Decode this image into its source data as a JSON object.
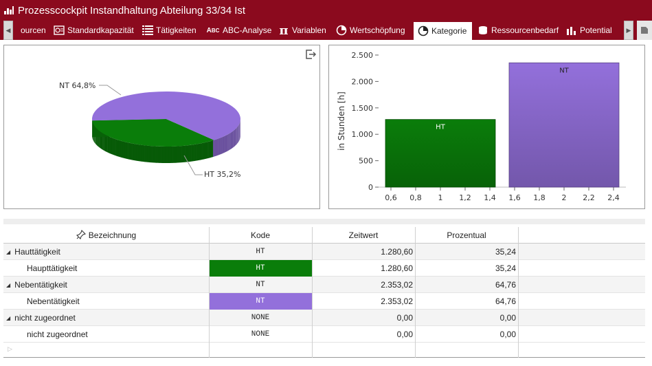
{
  "window": {
    "title": "Prozesscockpit Instandhaltung Abteilung 33/34 Ist"
  },
  "tabs": [
    {
      "label": "ourcen",
      "icon": "resources-icon"
    },
    {
      "label": "Standardkapazität",
      "icon": "capacity-icon"
    },
    {
      "label": "Tätigkeiten",
      "icon": "list-icon"
    },
    {
      "label": "ABC-Analyse",
      "icon": "abc-icon"
    },
    {
      "label": "Variablen",
      "icon": "pi-icon"
    },
    {
      "label": "Wertschöpfung",
      "icon": "pie-icon"
    },
    {
      "label": "Kategorie",
      "icon": "pie-icon",
      "active": true
    },
    {
      "label": "Ressourcenbedarf",
      "icon": "coins-icon"
    },
    {
      "label": "Potential",
      "icon": "bar-chart-icon"
    }
  ],
  "colors": {
    "brand": "#8b0a1e",
    "ht": "#0a7d0a",
    "nt": "#9370db"
  },
  "chart_data": [
    {
      "type": "pie",
      "slices": [
        {
          "label": "NT 64,8%",
          "name": "NT",
          "value": 64.8,
          "color": "#9370db"
        },
        {
          "label": "HT 35,2%",
          "name": "HT",
          "value": 35.2,
          "color": "#0a7d0a"
        }
      ],
      "style": "3d"
    },
    {
      "type": "bar",
      "ylabel": "in Stunden [h]",
      "xlabel": "",
      "ylim": [
        0,
        2500
      ],
      "xlim": [
        0.5,
        2.5
      ],
      "yticks": [
        "0",
        "500",
        "1.000",
        "1.500",
        "2.000",
        "2.500"
      ],
      "ytick_values": [
        0,
        500,
        1000,
        1500,
        2000,
        2500
      ],
      "xticks": [
        "0,6",
        "0,8",
        "1",
        "1,2",
        "1,4",
        "1,6",
        "1,8",
        "2",
        "2,2",
        "2,4"
      ],
      "xtick_values": [
        0.6,
        0.8,
        1.0,
        1.2,
        1.4,
        1.6,
        1.8,
        2.0,
        2.2,
        2.4
      ],
      "bars": [
        {
          "label": "HT",
          "x_start": 0.6,
          "x_end": 1.4,
          "value": 1280.6,
          "color": "#0a7d0a"
        },
        {
          "label": "NT",
          "x_start": 1.6,
          "x_end": 2.4,
          "value": 2353.02,
          "color": "#9370db"
        }
      ]
    }
  ],
  "grid": {
    "columns": [
      "Bezeichnung",
      "Kode",
      "Zeitwert",
      "Prozentual"
    ],
    "rows": [
      {
        "name": "Hauttätigkeit",
        "kode": "HT",
        "zeitwert": "1.280,60",
        "prozentual": "35,24",
        "group": true
      },
      {
        "name": "Haupttätigkeit",
        "kode": "HT",
        "zeitwert": "1.280,60",
        "prozentual": "35,24",
        "group": false,
        "kode_color": "#0a7d0a"
      },
      {
        "name": "Nebentätigkeit",
        "kode": "NT",
        "zeitwert": "2.353,02",
        "prozentual": "64,76",
        "group": true
      },
      {
        "name": "Nebentätigkeit",
        "kode": "NT",
        "zeitwert": "2.353,02",
        "prozentual": "64,76",
        "group": false,
        "kode_color": "#9370db"
      },
      {
        "name": "nicht zugeordnet",
        "kode": "NONE",
        "zeitwert": "0,00",
        "prozentual": "0,00",
        "group": true
      },
      {
        "name": "nicht zugeordnet",
        "kode": "NONE",
        "zeitwert": "0,00",
        "prozentual": "0,00",
        "group": false
      }
    ]
  }
}
